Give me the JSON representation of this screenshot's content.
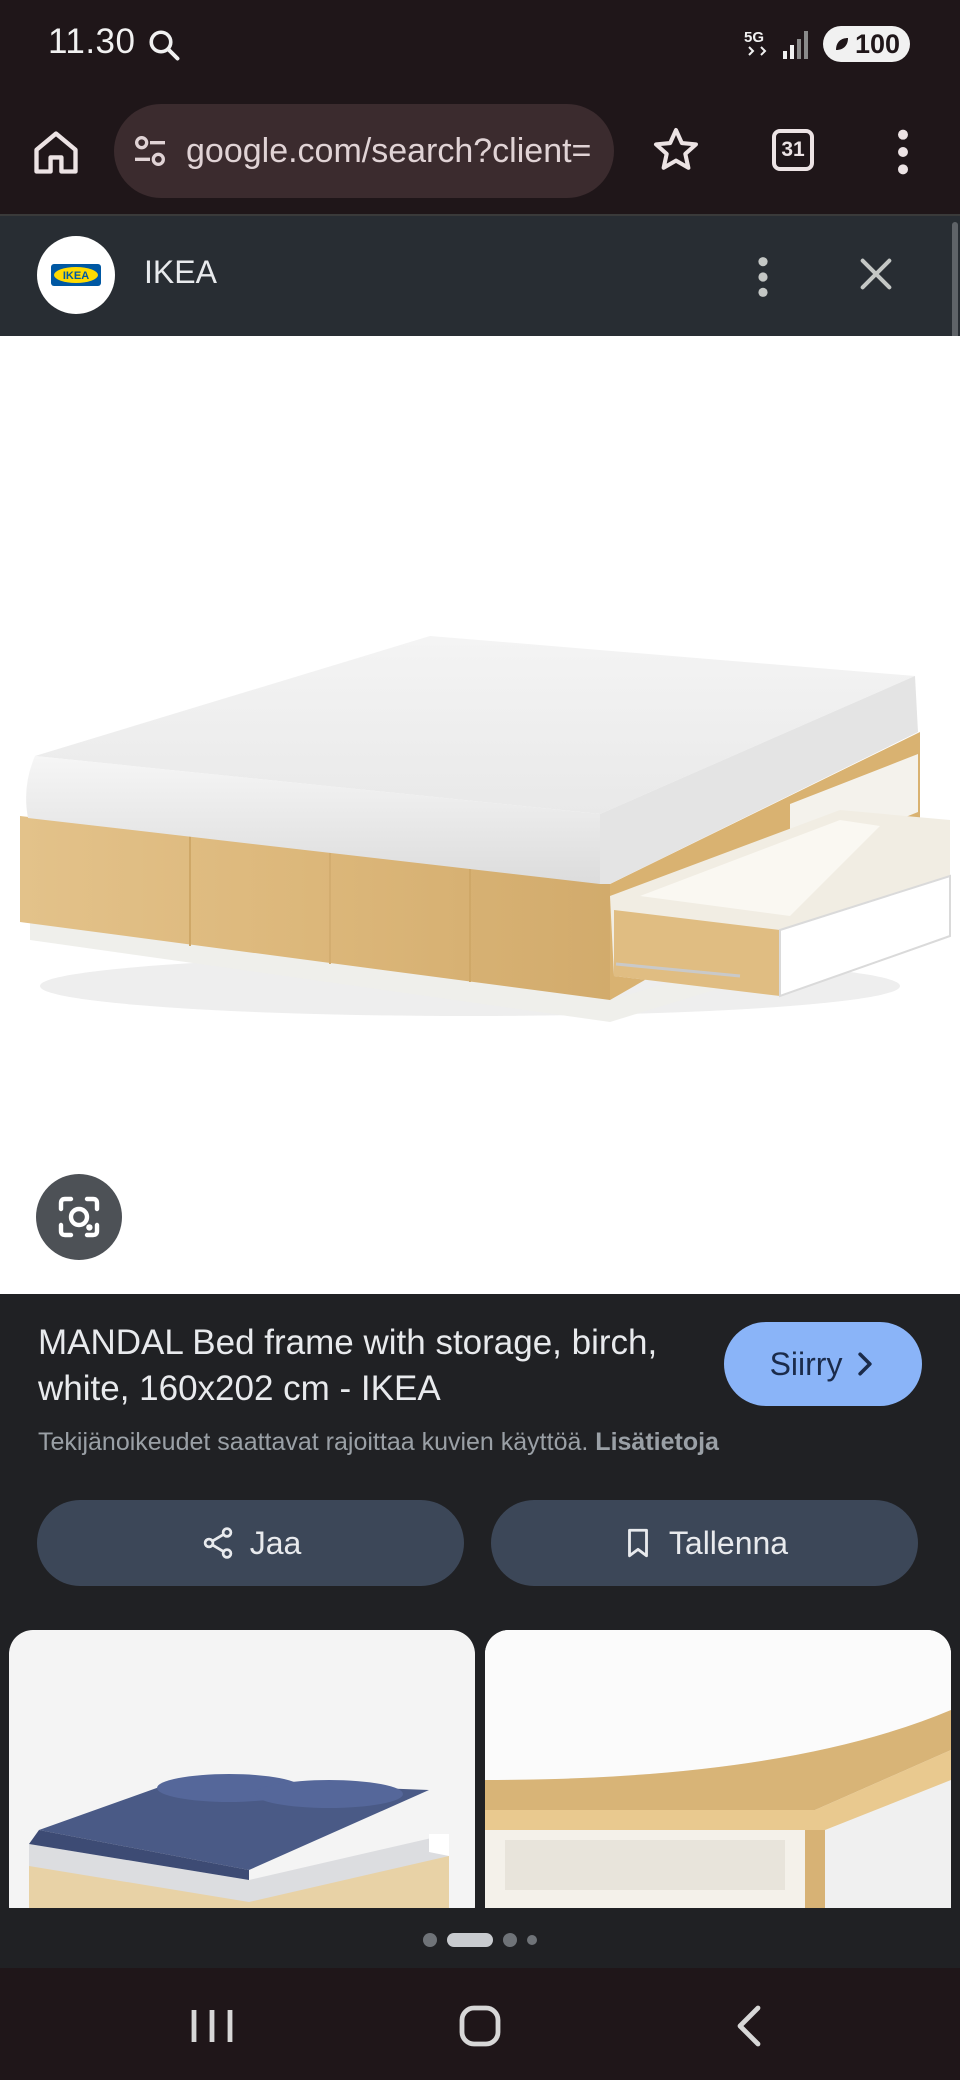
{
  "status_bar": {
    "time": "11.30",
    "network": "5G",
    "battery": "100",
    "icons": [
      "search-icon",
      "network-5g-icon",
      "signal-icon",
      "battery-icon"
    ]
  },
  "browser": {
    "url": "google.com/search?client=",
    "tab_count": "31",
    "icons": [
      "home-icon",
      "site-settings-icon",
      "bookmark-star-icon",
      "tabs-icon",
      "more-vert-icon"
    ]
  },
  "viewer": {
    "source_name": "IKEA",
    "source_logo_text": "IKEA",
    "brand_colors": {
      "ikea_blue": "#0058a3",
      "ikea_yellow": "#ffdb00"
    },
    "icons": [
      "more-vert-icon",
      "close-icon",
      "lens-icon"
    ]
  },
  "result": {
    "title": "MANDAL Bed frame with storage, birch, white, 160x202 cm - IKEA",
    "visit_label": "Siirry",
    "copyright_text": "Tekijänoikeudet saattavat rajoittaa kuvien käyttöä.",
    "copyright_link": "Lisätietoja",
    "share_label": "Jaa",
    "save_label": "Tallenna",
    "accent_color": "#8ab4f8"
  },
  "related": {
    "thumbnails": [
      "bed-navy-bedding",
      "bed-drawer-closeup"
    ],
    "page_indicator_count": 4,
    "active_page": 1
  },
  "nav": {
    "icons": [
      "recents-icon",
      "home-button-icon",
      "back-icon"
    ]
  }
}
